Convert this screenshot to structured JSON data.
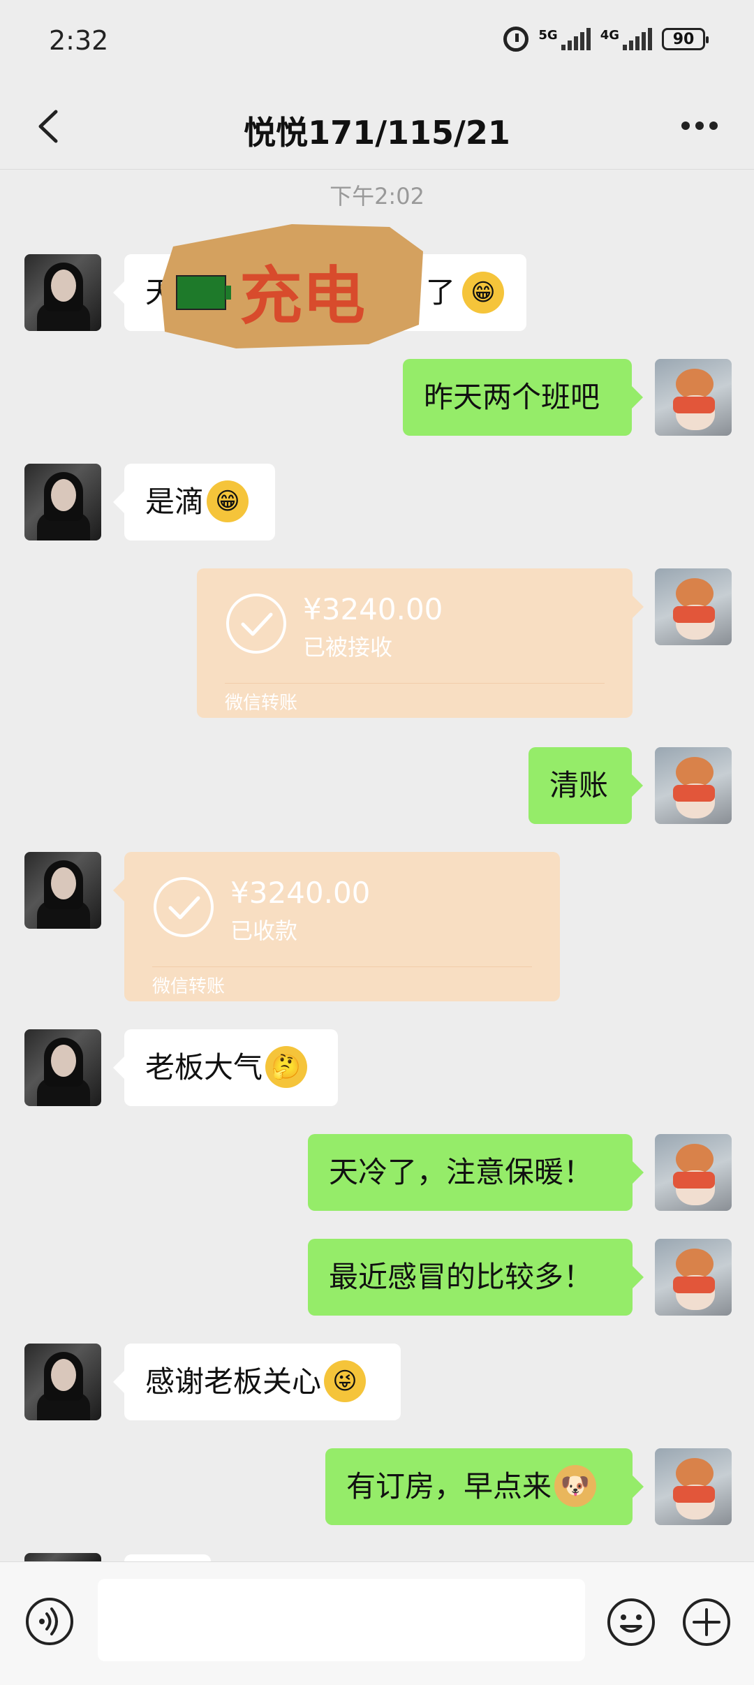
{
  "status_bar": {
    "time": "2:32",
    "network_1": "5G",
    "network_2": "4G",
    "battery": "90"
  },
  "header": {
    "title": "悦悦171/115/21",
    "back_icon": "chevron-left-icon",
    "more_icon": "more-horizontal-icon"
  },
  "timestamp": "下午2:02",
  "messages": [
    {
      "side": "in",
      "text": "天",
      "tail_text": "了",
      "emoji": "grin-emoji",
      "covered_by_sticker": true
    },
    {
      "side": "out",
      "text": "昨天两个班吧"
    },
    {
      "side": "in",
      "text": "是滴",
      "emoji": "grin-emoji"
    },
    {
      "side": "out",
      "type": "transfer",
      "amount": "¥3240.00",
      "status": "已被接收",
      "source": "微信转账"
    },
    {
      "side": "out",
      "text": "清账"
    },
    {
      "side": "in",
      "type": "transfer",
      "amount": "¥3240.00",
      "status": "已收款",
      "source": "微信转账"
    },
    {
      "side": "in",
      "text": "老板大气",
      "emoji": "thinking-emoji"
    },
    {
      "side": "out",
      "text": "天冷了，注意保暖！"
    },
    {
      "side": "out",
      "text": "最近感冒的比较多！"
    },
    {
      "side": "in",
      "text": "感谢老板关心",
      "emoji": "wink-tongue-emoji"
    },
    {
      "side": "out",
      "text": "有订房，早点来",
      "emoji": "doge-emoji"
    }
  ],
  "sticker": {
    "text": "充电",
    "icon": "battery-icon"
  },
  "input_bar": {
    "voice_icon": "voice-icon",
    "input_placeholder": "",
    "emoji_icon": "smile-icon",
    "plus_icon": "plus-icon"
  },
  "colors": {
    "background": "#ededed",
    "outgoing_bubble": "#95ec69",
    "incoming_bubble": "#ffffff",
    "transfer_card": "#f8dec2",
    "sticker_bg": "#d4a15f",
    "sticker_text": "#d84b2c"
  }
}
